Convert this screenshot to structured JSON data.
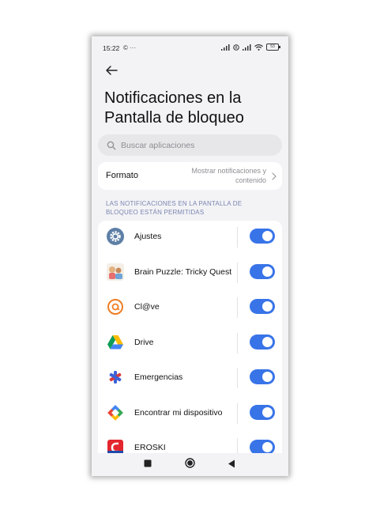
{
  "status_bar": {
    "time": "15:22",
    "left_icons": "© ···",
    "battery": "53"
  },
  "header": {
    "back_icon": "arrow-left-icon",
    "title": "Notificaciones en la Pantalla de bloqueo"
  },
  "search": {
    "placeholder": "Buscar aplicaciones"
  },
  "formato": {
    "label": "Formato",
    "value": "Mostrar notificaciones y contenido"
  },
  "section": {
    "heading": "LAS NOTIFICACIONES EN LA PANTALLA DE BLOQUEO ESTÁN PERMITIDAS"
  },
  "apps": [
    {
      "name": "Ajustes",
      "icon": "gear-icon",
      "enabled": true
    },
    {
      "name": "Brain Puzzle: Tricky Quest",
      "icon": "brain-puzzle-icon",
      "enabled": true
    },
    {
      "name": "Cl@ve",
      "icon": "clave-icon",
      "enabled": true
    },
    {
      "name": "Drive",
      "icon": "drive-icon",
      "enabled": true
    },
    {
      "name": "Emergencias",
      "icon": "emergency-icon",
      "enabled": true
    },
    {
      "name": "Encontrar mi dispositivo",
      "icon": "find-device-icon",
      "enabled": true
    },
    {
      "name": "EROSKI",
      "icon": "eroski-icon",
      "enabled": true
    }
  ],
  "colors": {
    "accent": "#3874e8",
    "background": "#f3f3f6",
    "section_heading": "#7b86b0"
  }
}
